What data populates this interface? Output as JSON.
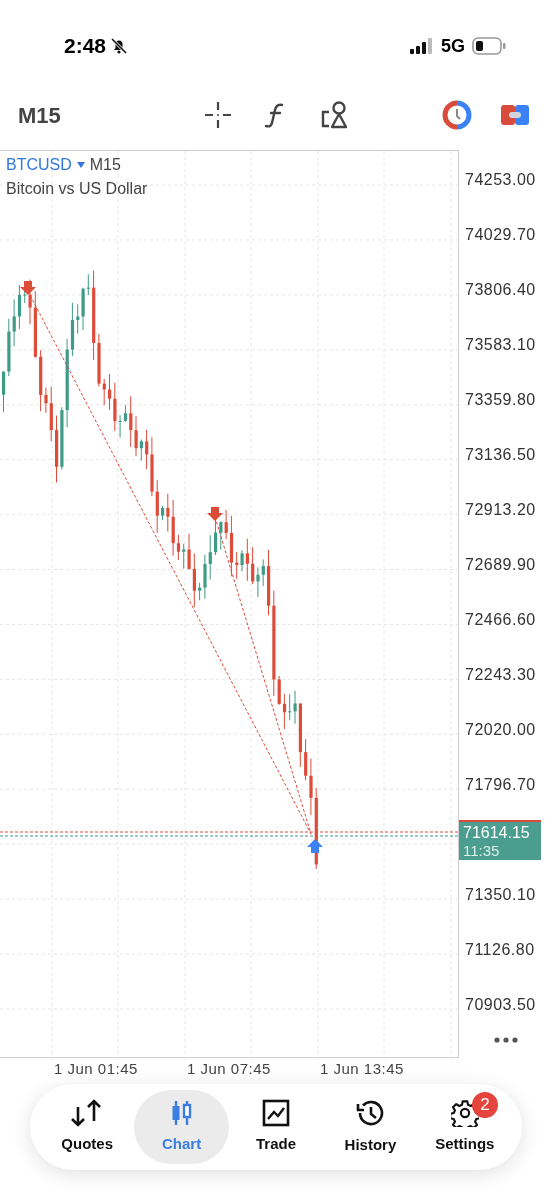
{
  "status_bar": {
    "time": "2:48",
    "network": "5G"
  },
  "toolbar": {
    "timeframe": "M15"
  },
  "chart": {
    "symbol": "BTCUSD",
    "timeframe": "M15",
    "description": "Bitcoin vs US Dollar"
  },
  "price_axis": [
    {
      "kind": "tick",
      "label": "74253.00"
    },
    {
      "kind": "tick",
      "label": "74029.70"
    },
    {
      "kind": "tick",
      "label": "73806.40"
    },
    {
      "kind": "tick",
      "label": "73583.10"
    },
    {
      "kind": "tick",
      "label": "73359.80"
    },
    {
      "kind": "tick",
      "label": "73136.50"
    },
    {
      "kind": "tick",
      "label": "72913.20"
    },
    {
      "kind": "tick",
      "label": "72689.90"
    },
    {
      "kind": "tick",
      "label": "72466.60"
    },
    {
      "kind": "tick",
      "label": "72243.30"
    },
    {
      "kind": "tick",
      "label": "72020.00"
    },
    {
      "kind": "tick",
      "label": "71796.70"
    },
    {
      "kind": "current",
      "price": "71614.15",
      "timer": "11:35"
    },
    {
      "kind": "tick",
      "label": "71350.10"
    },
    {
      "kind": "tick",
      "label": "71126.80"
    },
    {
      "kind": "tick",
      "label": "70903.50"
    }
  ],
  "time_axis": [
    "1 Jun 01:45",
    "1 Jun 07:45",
    "1 Jun 13:45"
  ],
  "nav": [
    {
      "label": "Quotes",
      "selected": false
    },
    {
      "label": "Chart",
      "selected": true
    },
    {
      "label": "Trade",
      "selected": false
    },
    {
      "label": "History",
      "selected": false
    },
    {
      "label": "Settings",
      "selected": false,
      "badge": "2"
    }
  ]
}
